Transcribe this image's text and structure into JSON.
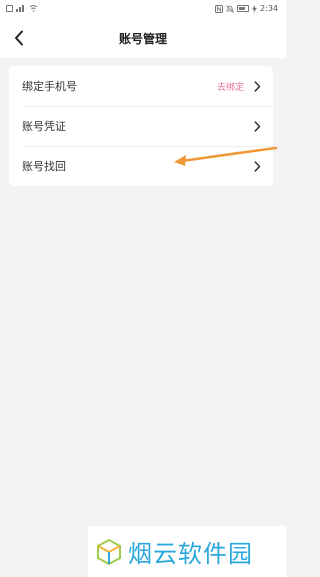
{
  "status_bar": {
    "time": "2:34",
    "left_icons": [
      "notification-icon",
      "signal-icon",
      "wifi-icon"
    ],
    "right_icons": [
      "nfc-icon",
      "mute-icon",
      "battery-icon",
      "charging-icon"
    ]
  },
  "header": {
    "title": "账号管理",
    "back_icon": "chevron-left-icon"
  },
  "settings": {
    "items": [
      {
        "label": "绑定手机号",
        "value": "去绑定",
        "icon": "chevron-right-icon"
      },
      {
        "label": "账号凭证",
        "value": "",
        "icon": "chevron-right-icon"
      },
      {
        "label": "账号找回",
        "value": "",
        "icon": "chevron-right-icon"
      }
    ]
  },
  "colors": {
    "accent_pink": "#e9729a",
    "annotation_orange": "#f0993a",
    "watermark_blue": "#2aa7dd",
    "background": "#f3f3f5"
  },
  "watermark": {
    "text": "烟云软件园"
  }
}
